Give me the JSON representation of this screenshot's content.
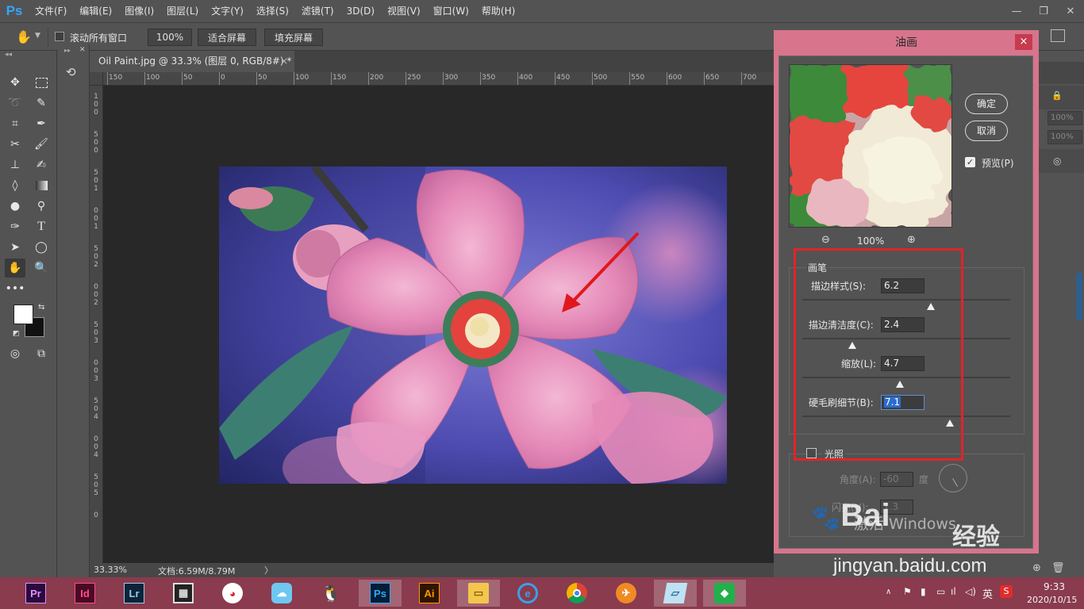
{
  "menu": {
    "logo": "Ps",
    "items": [
      "文件(F)",
      "编辑(E)",
      "图像(I)",
      "图层(L)",
      "文字(Y)",
      "选择(S)",
      "滤镜(T)",
      "3D(D)",
      "视图(V)",
      "窗口(W)",
      "帮助(H)"
    ]
  },
  "options": {
    "scroll_all": "滚动所有窗口",
    "zoom": "100%",
    "fit_screen": "适合屏幕",
    "fill_screen": "填充屏幕"
  },
  "document": {
    "tab_title": "Oil Paint.jpg @ 33.3% (图层 0, RGB/8#) *",
    "close": "×",
    "ruler_top": [
      "150",
      "100",
      "50",
      "0",
      "50",
      "100",
      "150",
      "200",
      "250",
      "300",
      "350",
      "400",
      "450",
      "500",
      "550",
      "600",
      "650",
      "700"
    ],
    "ruler_left": [
      "1",
      "0",
      "0",
      "5",
      "0",
      "0",
      "5",
      "0",
      "1",
      "0",
      "0",
      "1",
      "5",
      "0",
      "2",
      "0",
      "0",
      "2",
      "5",
      "0",
      "3",
      "0",
      "0",
      "3",
      "5",
      "0",
      "4",
      "0",
      "0",
      "4",
      "5",
      "0",
      "5",
      "0"
    ],
    "zoom_status": "33.33%",
    "doc_size": "文档:6.59M/8.79M"
  },
  "dialog": {
    "title": "油画",
    "close": "×",
    "ok": "确定",
    "cancel": "取消",
    "preview_label": "预览(P)",
    "preview_checked": true,
    "zoom": "100%",
    "brush_group": "画笔",
    "stylization_label": "描边样式(S):",
    "stylization_value": "6.2",
    "stylization_level": 0.62,
    "cleanliness_label": "描边清洁度(C):",
    "cleanliness_value": "2.4",
    "cleanliness_level": 0.24,
    "scale_label": "缩放(L):",
    "scale_value": "4.7",
    "scale_level": 0.47,
    "bristle_label": "硬毛刷细节(B):",
    "bristle_value": "7.1",
    "bristle_level": 0.71,
    "lighting_label": "光照",
    "angle_label": "角度(A):",
    "angle_value": "-60",
    "angle_unit": "度",
    "shine_label": "闪亮(H):",
    "shine_value": "1.3"
  },
  "panels": {
    "pct1": "100%",
    "pct2": "100%"
  },
  "watermark": {
    "activate": "激活 Windows",
    "brand": "Bai",
    "brand_cn": "经验",
    "url": "jingyan.baidu.com"
  },
  "taskbar": {
    "apps": [
      "Pr",
      "Id",
      "Lr",
      "Ps",
      "Ai"
    ],
    "ime": "英",
    "time": "9:33",
    "date": "2020/10/15"
  },
  "colors": {
    "ps_blue": "#31a8ff",
    "dialog_frame": "#d8748c",
    "highlight_box": "#e0242a",
    "taskbar": "#8a3b4d"
  }
}
